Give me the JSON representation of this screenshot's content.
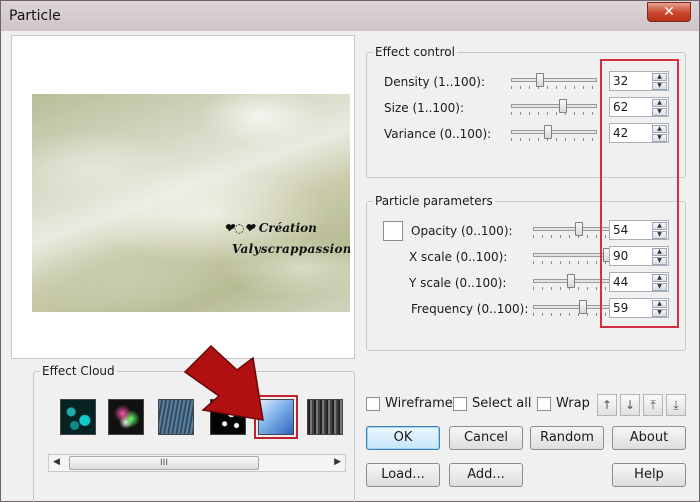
{
  "window": {
    "title": "Particle",
    "close_label": "✕"
  },
  "preview": {
    "watermark_line1": "❤◌❤ Création",
    "watermark_line2": "Valyscrappassion"
  },
  "effect_control": {
    "title": "Effect control",
    "rows": [
      {
        "label": "Density (1..100):",
        "value": "32",
        "fraction": 0.32
      },
      {
        "label": "Size (1..100):",
        "value": "62",
        "fraction": 0.62
      },
      {
        "label": "Variance (0..100):",
        "value": "42",
        "fraction": 0.42
      }
    ]
  },
  "particle_parameters": {
    "title": "Particle parameters",
    "rows": [
      {
        "label": "Opacity (0..100):",
        "value": "54",
        "fraction": 0.54
      },
      {
        "label": "X scale (0..100):",
        "value": "90",
        "fraction": 0.9
      },
      {
        "label": "Y scale (0..100):",
        "value": "44",
        "fraction": 0.44
      },
      {
        "label": "Frequency (0..100):",
        "value": "59",
        "fraction": 0.59
      }
    ]
  },
  "effect_cloud": {
    "title": "Effect Cloud",
    "selected_index": 4,
    "scroll_grip": "III"
  },
  "options": {
    "wireframe": "Wireframe",
    "select_all": "Select all",
    "wrap": "Wrap"
  },
  "buttons": {
    "ok": "OK",
    "cancel": "Cancel",
    "random": "Random",
    "about": "About",
    "load": "Load...",
    "add": "Add...",
    "help": "Help"
  },
  "colors": {
    "highlight_red": "#d03040",
    "arrow_red": "#b01010",
    "accent_blue": "#3c7fb1"
  }
}
